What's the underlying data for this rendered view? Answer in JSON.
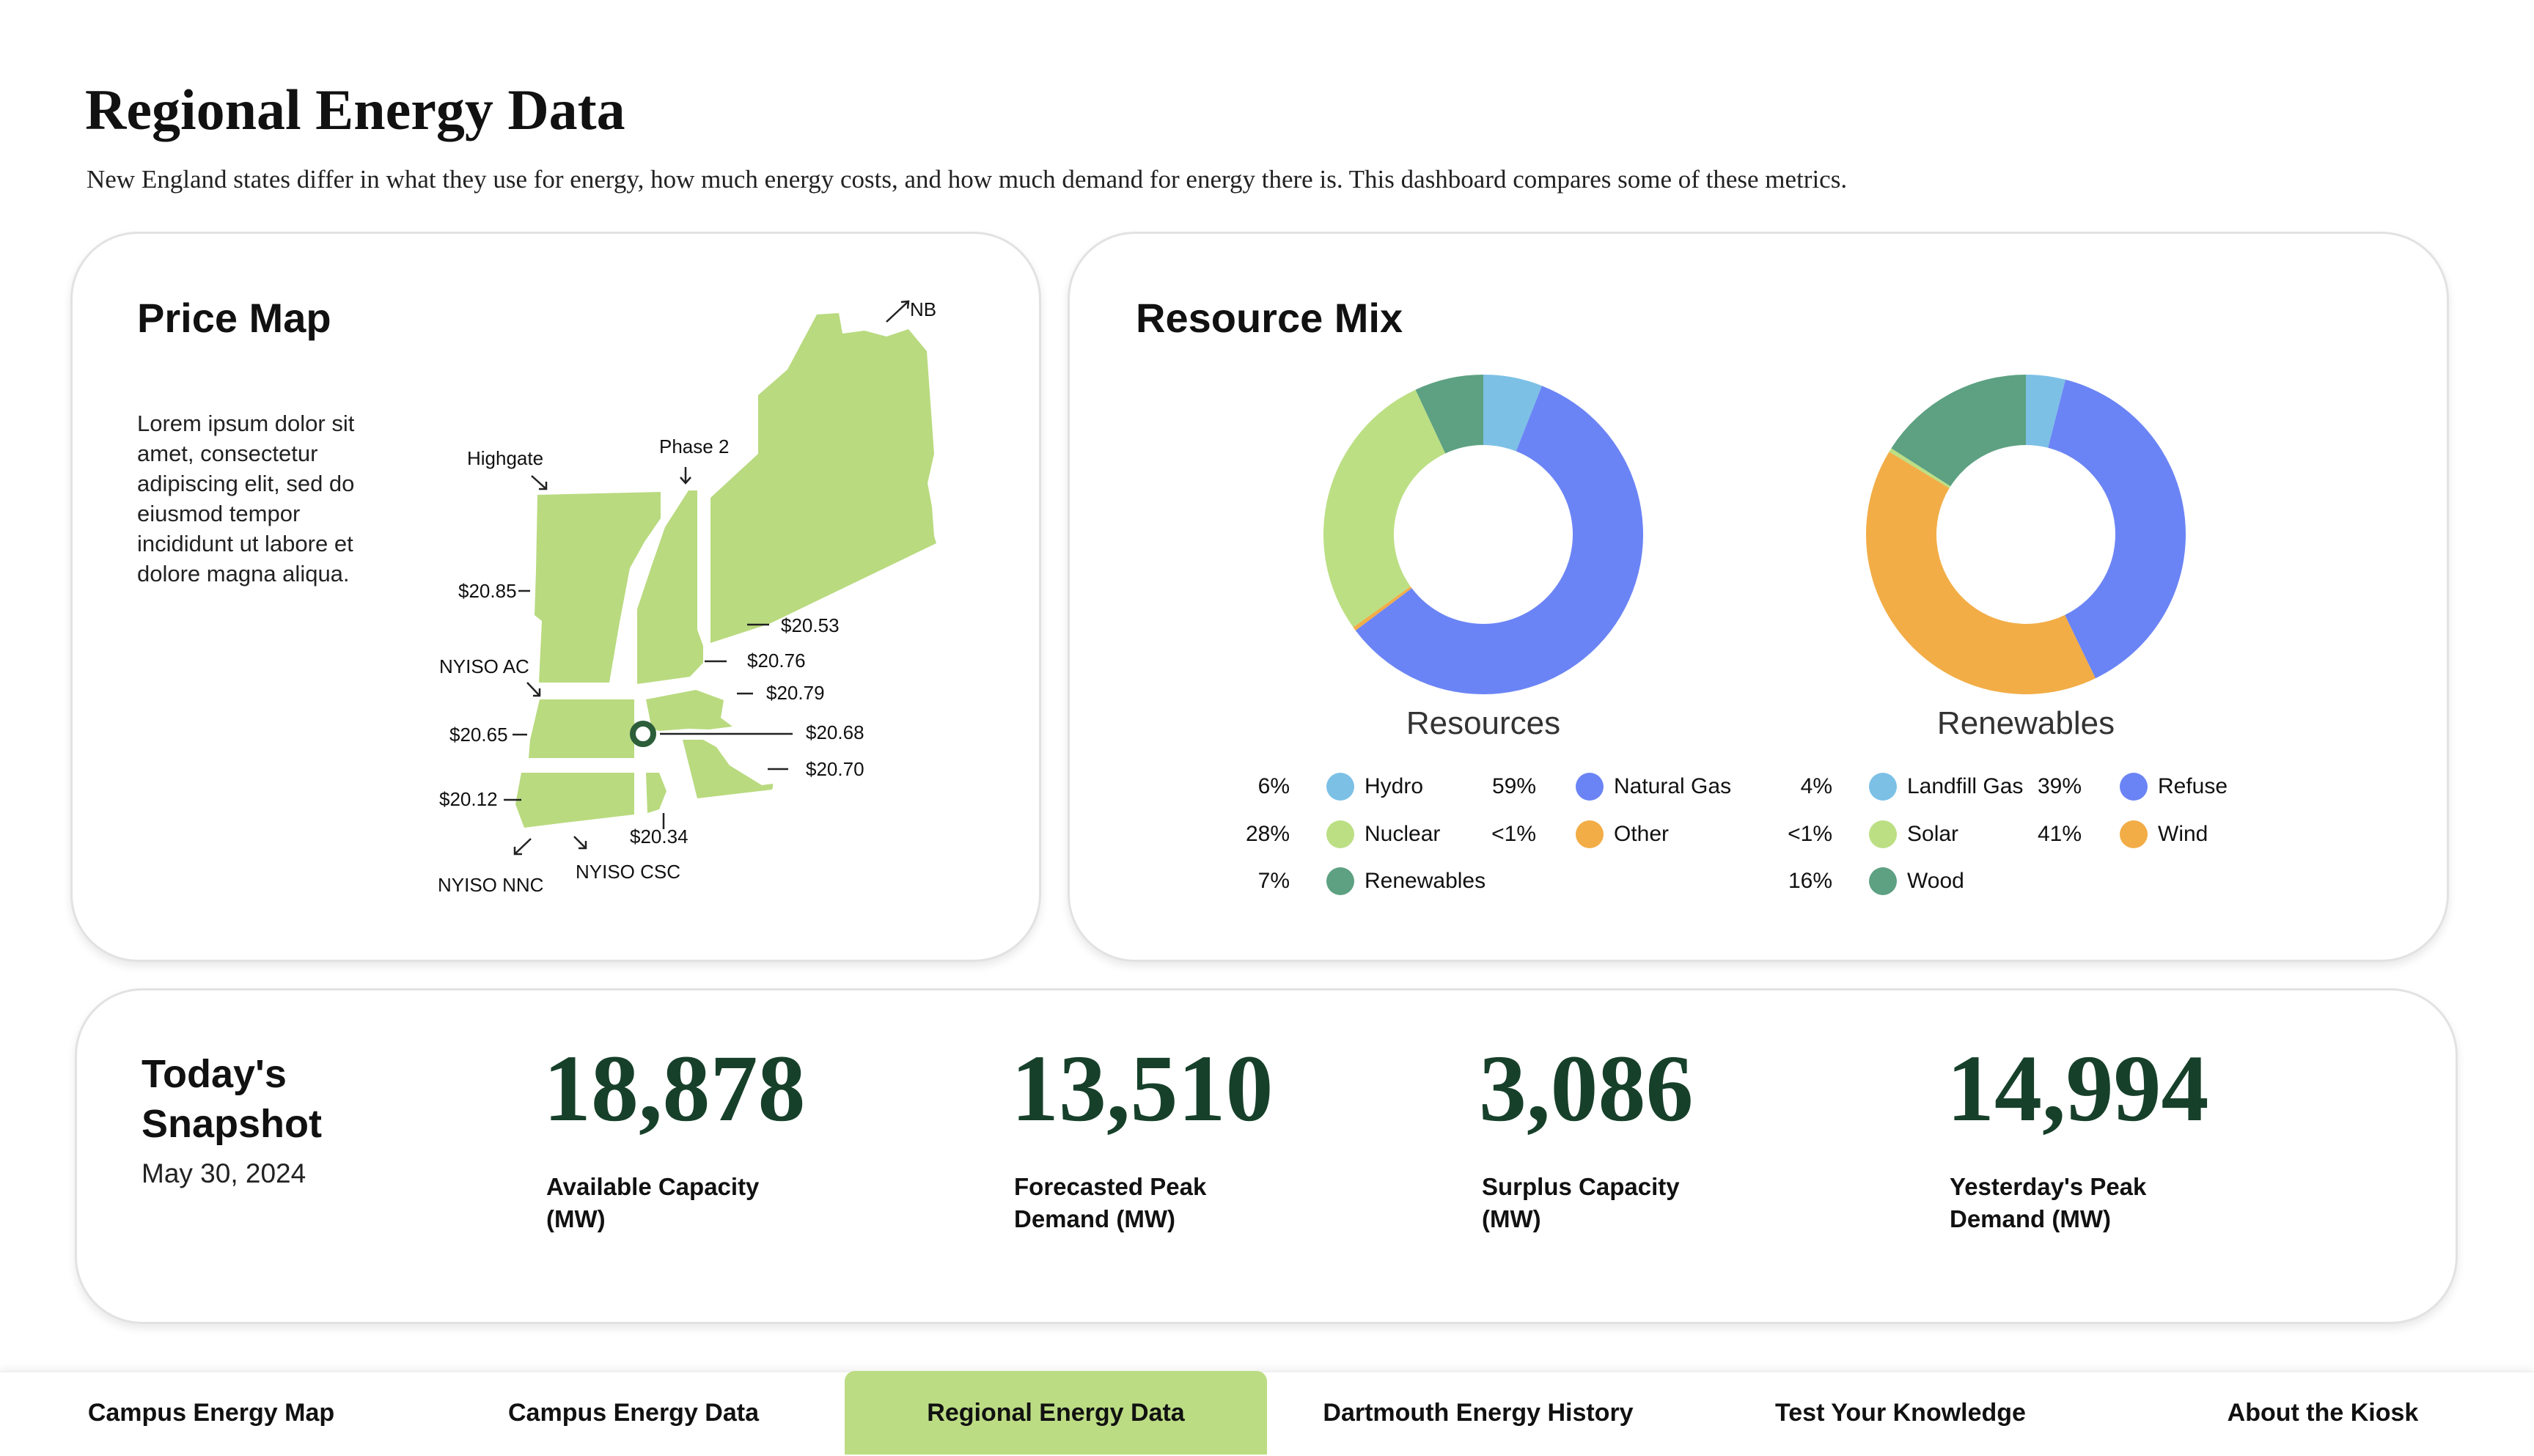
{
  "page": {
    "title": "Regional Energy Data",
    "subtitle": "New England states differ in what they use for energy, how much energy costs, and how much demand for energy there is. This dashboard compares some of these metrics."
  },
  "price_map": {
    "title": "Price Map",
    "description": "Lorem ipsum dolor sit amet, consectetur adipiscing elit, sed do eiusmod tempor incididunt ut labore et dolore magna aliqua.",
    "labels": {
      "nb": "NB",
      "highgate": "Highgate",
      "phase2": "Phase 2",
      "nyiso_ac": "NYISO AC",
      "nyiso_nnc": "NYISO NNC",
      "nyiso_csc": "NYISO CSC",
      "p1": "$20.85",
      "p2": "$20.53",
      "p3": "$20.76",
      "p4": "$20.79",
      "p5": "$20.65",
      "p6": "$20.68",
      "p7": "$20.70",
      "p8": "$20.12",
      "p9": "$20.34"
    },
    "colors": {
      "land": "#b9da7f",
      "marker": "#2c5e3a"
    }
  },
  "resource_mix": {
    "title": "Resource Mix",
    "resources": {
      "title": "Resources",
      "items": [
        {
          "pct": "6%",
          "name": "Hydro",
          "color": "#7cc0e6",
          "value": 6
        },
        {
          "pct": "59%",
          "name": "Natural Gas",
          "color": "#6b84f5",
          "value": 59
        },
        {
          "pct": "<1%",
          "name": "Other",
          "color": "#f2ad47",
          "value": 0.4
        },
        {
          "pct": "28%",
          "name": "Nuclear",
          "color": "#bcdf84",
          "value": 28
        },
        {
          "pct": "7%",
          "name": "Renewables",
          "color": "#5da182",
          "value": 7
        }
      ]
    },
    "renewables": {
      "title": "Renewables",
      "items": [
        {
          "pct": "4%",
          "name": "Landfill Gas",
          "color": "#7cc0e6",
          "value": 4
        },
        {
          "pct": "39%",
          "name": "Refuse",
          "color": "#6b84f5",
          "value": 39
        },
        {
          "pct": "41%",
          "name": "Wind",
          "color": "#f2ad47",
          "value": 41
        },
        {
          "pct": "<1%",
          "name": "Solar",
          "color": "#bcdf84",
          "value": 0.4
        },
        {
          "pct": "16%",
          "name": "Wood",
          "color": "#5da182",
          "value": 16
        }
      ]
    }
  },
  "snapshot": {
    "title_line1": "Today's",
    "title_line2": "Snapshot",
    "date": "May 30, 2024",
    "stats": [
      {
        "value": "18,878",
        "label_line1": "Available Capacity",
        "label_line2": "(MW)"
      },
      {
        "value": "13,510",
        "label_line1": "Forecasted Peak",
        "label_line2": "Demand (MW)"
      },
      {
        "value": "3,086",
        "label_line1": "Surplus Capacity",
        "label_line2": "(MW)"
      },
      {
        "value": "14,994",
        "label_line1": "Yesterday's Peak",
        "label_line2": "Demand (MW)"
      }
    ]
  },
  "nav": {
    "active_color": "#bcdc84",
    "tabs": [
      {
        "label": "Campus Energy Map"
      },
      {
        "label": "Campus Energy Data"
      },
      {
        "label": "Regional Energy Data",
        "active": true
      },
      {
        "label": "Dartmouth Energy History"
      },
      {
        "label": "Test Your Knowledge"
      },
      {
        "label": "About the Kiosk"
      }
    ]
  }
}
